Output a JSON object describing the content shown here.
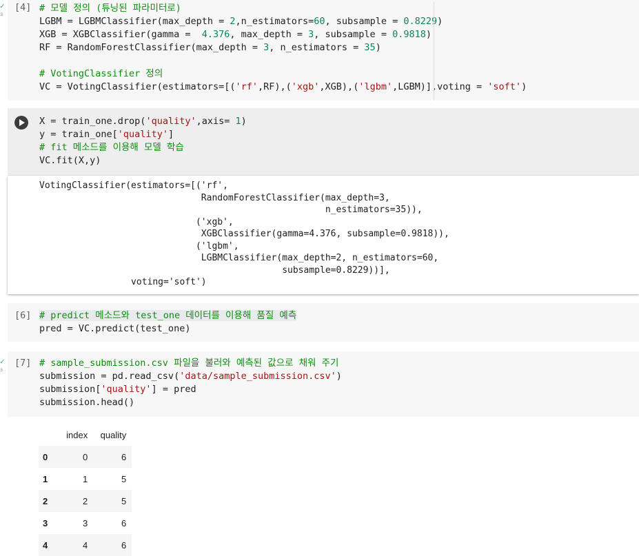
{
  "cells": [
    {
      "count": "[4]",
      "lines": [
        [
          {
            "t": "# 모델 정의 (튜닝된 파라미터로)",
            "c": "cm"
          }
        ],
        [
          {
            "t": "LGBM = LGBMClassifier(max_depth = "
          },
          {
            "t": "2",
            "c": "nu"
          },
          {
            "t": ",n_estimators="
          },
          {
            "t": "60",
            "c": "nu"
          },
          {
            "t": ", subsample = "
          },
          {
            "t": "0.8229",
            "c": "nu"
          },
          {
            "t": ")"
          }
        ],
        [
          {
            "t": "XGB = XGBClassifier(gamma =  "
          },
          {
            "t": "4.376",
            "c": "nu"
          },
          {
            "t": ", max_depth = "
          },
          {
            "t": "3",
            "c": "nu"
          },
          {
            "t": ", subsample = "
          },
          {
            "t": "0.9818",
            "c": "nu"
          },
          {
            "t": ")"
          }
        ],
        [
          {
            "t": "RF = RandomForestClassifier(max_depth = "
          },
          {
            "t": "3",
            "c": "nu"
          },
          {
            "t": ", n_estimators = "
          },
          {
            "t": "35",
            "c": "nu"
          },
          {
            "t": ")"
          }
        ],
        [
          {
            "t": ""
          }
        ],
        [
          {
            "t": "# VotingClassifier 정의",
            "c": "cm"
          }
        ],
        [
          {
            "t": "VC = VotingClassifier(estimators=[("
          },
          {
            "t": "'rf'",
            "c": "st"
          },
          {
            "t": ",RF),("
          },
          {
            "t": "'xgb'",
            "c": "st"
          },
          {
            "t": ",XGB),("
          },
          {
            "t": "'lgbm'",
            "c": "st"
          },
          {
            "t": ",LGBM)],voting = "
          },
          {
            "t": "'soft'",
            "c": "st"
          },
          {
            "t": ")"
          }
        ]
      ]
    },
    {
      "count": "",
      "lines": [
        [
          {
            "t": "X = train_one.drop("
          },
          {
            "t": "'quality'",
            "c": "st"
          },
          {
            "t": ",axis= "
          },
          {
            "t": "1",
            "c": "nu"
          },
          {
            "t": ")"
          }
        ],
        [
          {
            "t": "y = train_one["
          },
          {
            "t": "'quality'",
            "c": "st"
          },
          {
            "t": "]"
          }
        ],
        [
          {
            "t": "# fit 메소드를 이용해 모델 학습",
            "c": "cm"
          }
        ],
        [
          {
            "t": "VC.fit(X,y)"
          }
        ]
      ]
    },
    {
      "count": "[6]",
      "lines": [
        [
          {
            "t": "# predict 메소드와 test_one 데이터를 이용해 품질 예측",
            "c": "cm"
          }
        ],
        [
          {
            "t": "pred = VC.predict(test_one)"
          }
        ]
      ]
    },
    {
      "count": "[7]",
      "lines": [
        [
          {
            "t": "# sample_submission.csv 파일을 불러와 예측된 값으로 채워 주기",
            "c": "cm"
          }
        ],
        [
          {
            "t": "submission = pd.read_csv("
          },
          {
            "t": "'data/sample_submission.csv'",
            "c": "st"
          },
          {
            "t": ")"
          }
        ],
        [
          {
            "t": "submission["
          },
          {
            "t": "'quality'",
            "c": "st"
          },
          {
            "t": "] = pred"
          }
        ],
        [
          {
            "t": "submission.head()"
          }
        ]
      ]
    }
  ],
  "fit_output": [
    "VotingClassifier(estimators=[('rf',",
    "                              RandomForestClassifier(max_depth=3,",
    "                                                     n_estimators=35)),",
    "                             ('xgb',",
    "                              XGBClassifier(gamma=4.376, subsample=0.9818)),",
    "                             ('lgbm',",
    "                              LGBMClassifier(max_depth=2, n_estimators=60,",
    "                                             subsample=0.8229))],",
    "                 voting='soft')"
  ],
  "dataframe": {
    "columns": [
      "index",
      "quality"
    ],
    "rows": [
      {
        "label": "0",
        "index": "0",
        "quality": "6"
      },
      {
        "label": "1",
        "index": "1",
        "quality": "5"
      },
      {
        "label": "2",
        "index": "2",
        "quality": "5"
      },
      {
        "label": "3",
        "index": "3",
        "quality": "6"
      },
      {
        "label": "4",
        "index": "4",
        "quality": "6"
      }
    ]
  },
  "gutter": {
    "check": "✓",
    "sub": "s"
  },
  "colors": {
    "comment": "#0f8c0f",
    "string": "#a31515",
    "number": "#098658",
    "cell_bg": "#f7f7f7",
    "run_button": "#3c3c3c"
  }
}
